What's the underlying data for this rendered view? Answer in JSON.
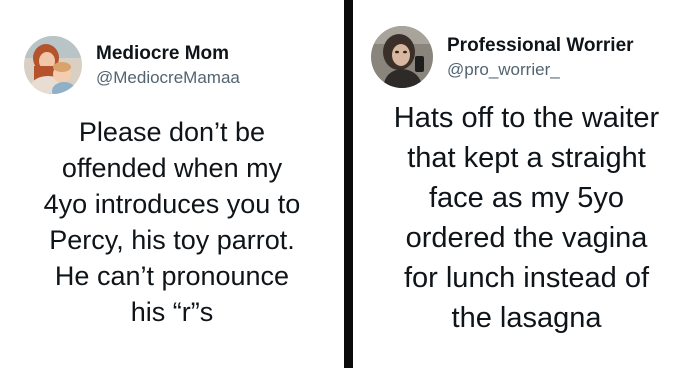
{
  "tweets": [
    {
      "display_name": "Mediocre Mom",
      "handle": "@MediocreMamaa",
      "avatar_icon": "profile-photo-mother-and-child",
      "text": "Please don’t be\noffended when my\n4yo introduces you to\nPercy, his toy parrot.\nHe can’t pronounce\nhis “r”s"
    },
    {
      "display_name": "Professional Worrier",
      "handle": "@pro_worrier_",
      "avatar_icon": "profile-photo-woman",
      "text": "Hats off to the waiter\nthat kept a straight\nface as my 5yo\nordered the vagina\nfor lunch instead of\nthe lasagna"
    }
  ],
  "colors": {
    "text": "#0f1419",
    "handle": "#536471",
    "divider": "#0b0b0b",
    "background": "#ffffff"
  }
}
